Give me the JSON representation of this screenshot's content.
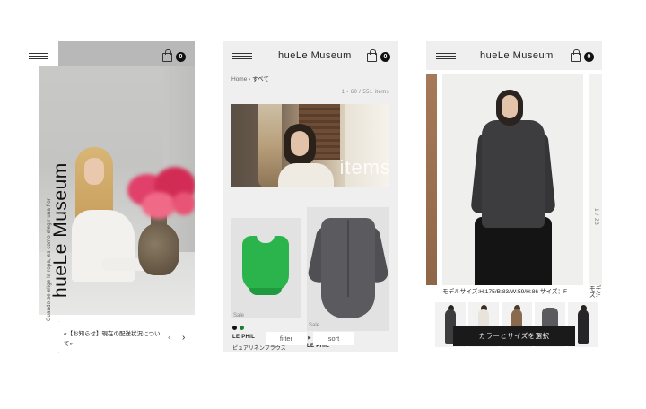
{
  "phone1": {
    "vertical_logo": "hueLe Museum",
    "vertical_tagline": "Cuando se elige la ropa, es como elegir una flor",
    "cart_count": "0",
    "news_text": "«【お知らせ】現在の配送状況について»",
    "prev_arrow": "‹",
    "next_arrow": "›"
  },
  "phone2": {
    "brand": "hueLe Museum",
    "cart_count": "0",
    "breadcrumb_home": "Home",
    "breadcrumb_sep": "›",
    "breadcrumb_current": "すべて",
    "item_count": "1 - 60  /  551 items",
    "banner_word": "items",
    "products": [
      {
        "badge": "Sale",
        "brand": "LE PHIL",
        "name": "ピュアリネンブラウス",
        "swatches": [
          "#111111",
          "#1f7a3a"
        ]
      },
      {
        "badge": "Sale",
        "brand": "LE PHIL"
      }
    ],
    "filter_label": "filter",
    "sort_label": "sort",
    "caret": "▶"
  },
  "phone3": {
    "brand": "hueLe Museum",
    "cart_count": "0",
    "page_indicator": "1 / 23",
    "model_info": "モデルサイズ:H:175/B:83/W:59/H:86 サイズ：F",
    "model_info_cut": "モデ\nズ:F",
    "cta_label": "カラーとサイズを選択"
  },
  "colors": {
    "cta_bg": "#1a1a1a",
    "green_item": "#2bb34c",
    "gray_item": "#5b5b5f"
  }
}
